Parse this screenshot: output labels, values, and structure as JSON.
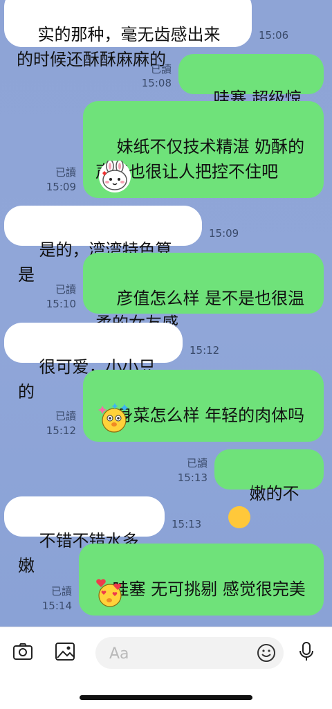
{
  "messages": [
    {
      "side": "in",
      "text": "实的那种，毫无齿感出来\n的时候还酥酥麻麻的",
      "time": "15:06"
    },
    {
      "side": "out",
      "text": "哇塞 超级惊喜",
      "read": "已讀",
      "time": "15:08"
    },
    {
      "side": "out",
      "text": "妹纸不仅技术精湛 奶酥的\n声音也很让人把控不住吧",
      "read": "已讀",
      "time": "15:09",
      "sticker": "bunny-face-sticker"
    },
    {
      "side": "in",
      "text": "是的，湾湾特色算是",
      "time": "15:09"
    },
    {
      "side": "out",
      "text": "彦值怎么样 是不是也很温\n柔的女友感",
      "read": "已讀",
      "time": "15:10"
    },
    {
      "side": "in",
      "text": "很可爱，小小只的",
      "time": "15:12"
    },
    {
      "side": "out",
      "text": "身菜怎么样 年轻的肉体吗",
      "read": "已讀",
      "time": "15:12",
      "sticker": "dazzled-chick-sticker"
    },
    {
      "side": "out",
      "text": "嫩的不",
      "read": "已讀",
      "time": "15:13",
      "inline_emoji": "hand-over-mouth-emoji"
    },
    {
      "side": "in",
      "text": "不错不错水多嫩",
      "time": "15:13"
    },
    {
      "side": "out",
      "text": "哇塞 无可挑剔 感觉很完美",
      "read": "已讀",
      "time": "15:14",
      "sticker": "heart-eyes-chick-sticker"
    }
  ],
  "input": {
    "placeholder": "Aa"
  },
  "colors": {
    "outgoing": "#6fe27a",
    "incoming": "#ffffff",
    "background": "#8ea4d6"
  }
}
